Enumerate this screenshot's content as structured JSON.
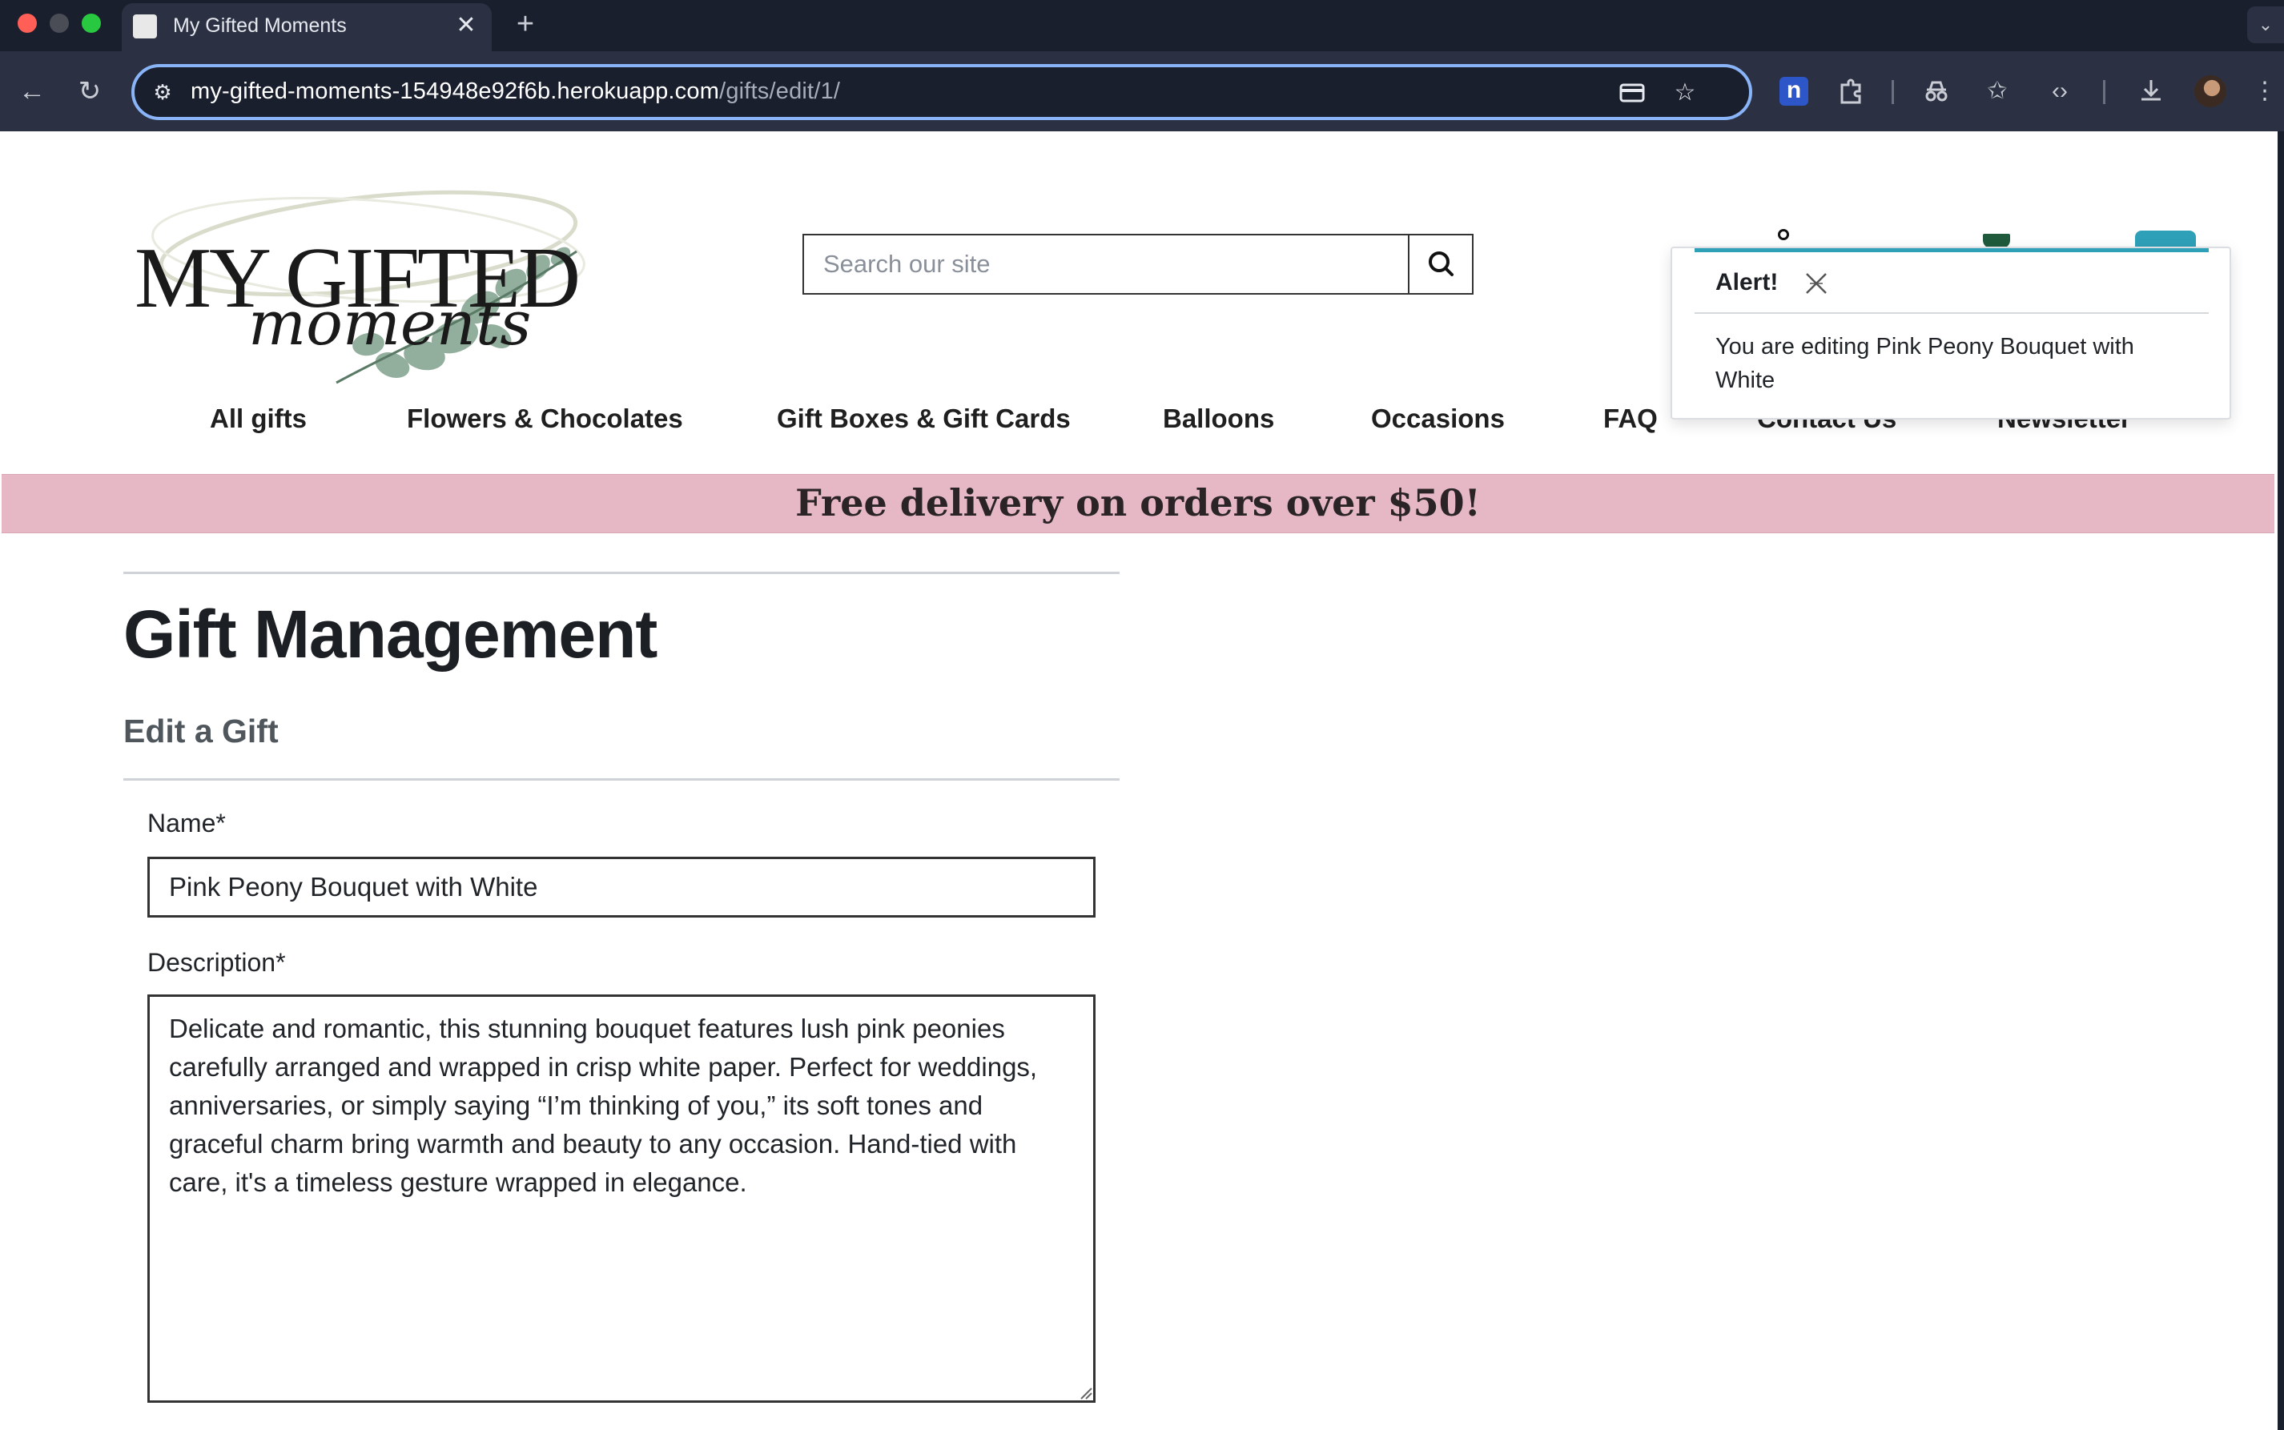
{
  "browser": {
    "tab_title": "My Gifted Moments",
    "tab_close_glyph": "✕",
    "new_tab_glyph": "+",
    "url_host": "my-gifted-moments-154948e92f6b.herokuapp.com",
    "url_path": "/gifts/edit/1/",
    "extension_letter": "n"
  },
  "header": {
    "logo_main": "MY GIFTED",
    "logo_script": "moments",
    "search_placeholder": "Search our site"
  },
  "nav": {
    "items": [
      "All gifts",
      "Flowers & Chocolates",
      "Gift Boxes & Gift Cards",
      "Balloons",
      "Occasions",
      "FAQ",
      "Contact Us",
      "Newsletter"
    ]
  },
  "banner": {
    "text": "Free delivery on orders over $50!"
  },
  "main": {
    "title": "Gift Management",
    "subtitle": "Edit a Gift",
    "name_label": "Name*",
    "name_value": "Pink Peony Bouquet with White",
    "description_label": "Description*",
    "description_value": "Delicate and romantic, this stunning bouquet features lush pink peonies carefully arranged and wrapped in crisp white paper. Perfect for weddings, anniversaries, or simply saying “I’m thinking of you,” its soft tones and graceful charm bring warmth and beauty to any occasion. Hand-tied with care, it's a timeless gesture wrapped in elegance."
  },
  "alert": {
    "title": "Alert!",
    "message": "You are editing Pink Peony Bouquet with White"
  },
  "colors": {
    "banner_bg": "#e6b8c6",
    "alert_accent": "#2ea0b8",
    "omnibox_focus": "#8ab4f8",
    "chrome_dark": "#1a1f2e"
  }
}
